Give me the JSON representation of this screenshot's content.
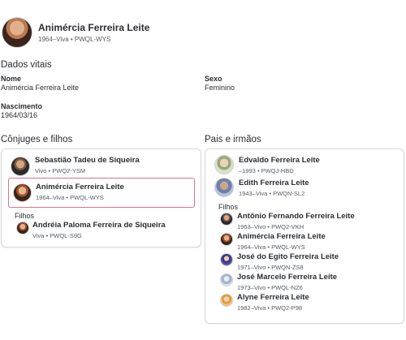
{
  "header": {
    "name": "Animércia Ferreira Leite",
    "subtitle": "1964–Viva • PWQL-WYS"
  },
  "vitals": {
    "title": "Dados vitais",
    "name_label": "Nome",
    "name_value": "Animércia Ferreira Leite",
    "sex_label": "Sexo",
    "sex_value": "Feminino",
    "birth_label": "Nascimento",
    "birth_value": "1964/03/16"
  },
  "spouses": {
    "title": "Cônjuges e filhos",
    "spouse": {
      "name": "Sebastião Tadeu de Siqueira",
      "sub": "Vivo • PWQ2-YSM"
    },
    "self": {
      "name": "Animércia Ferreira Leite",
      "sub": "1964–Viva • PWQL-WYS"
    },
    "children_label": "Filhos",
    "children": [
      {
        "name": "Andréia Paloma Ferreira de Siqueira",
        "sub": "Viva • PWQL-S9G"
      }
    ]
  },
  "parents": {
    "title": "Pais e irmãos",
    "father": {
      "name": "Edvaldo Ferreira Leite",
      "sub": "–1993 • PWQJ-HBD"
    },
    "mother": {
      "name": "Edith Ferreira Leite",
      "sub": "1943–Viva • PWQN-SL2"
    },
    "children_label": "Filhos",
    "children": [
      {
        "name": "Antônio Fernando Ferreira Leite",
        "sub": "1963–Vivo • PWQ2-VKH"
      },
      {
        "name": "Animércia Ferreira Leite",
        "sub": "1964–Viva • PWQL-WYS"
      },
      {
        "name": "José do Egito Ferreira Leite",
        "sub": "1971–Vivo • PWQN-ZS8"
      },
      {
        "name": "José Marcelo Ferreira Leite",
        "sub": "1973–Vivo • PWQL-NZ6"
      },
      {
        "name": "Alyne Ferreira Leite",
        "sub": "1982–Viva • PWQ2-P98"
      }
    ]
  }
}
